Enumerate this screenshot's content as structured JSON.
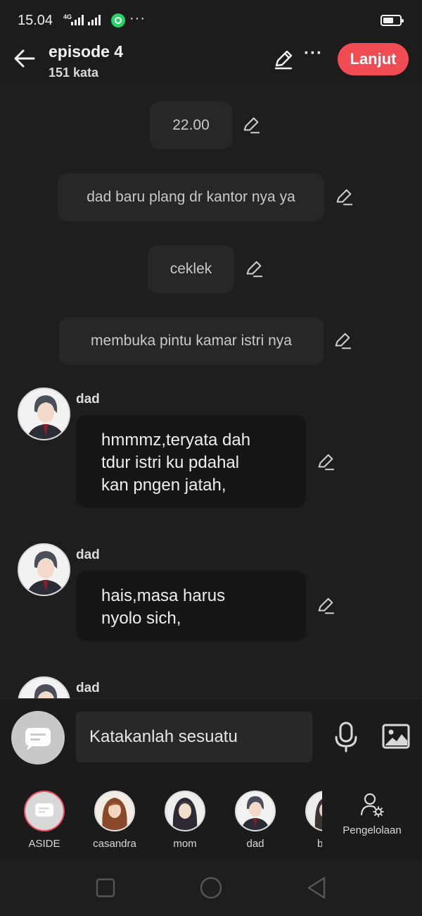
{
  "status_bar": {
    "time": "15.04",
    "network": "4G"
  },
  "header": {
    "title": "episode 4",
    "word_count": "151 kata",
    "next_button": "Lanjut"
  },
  "messages": [
    {
      "type": "narration",
      "text": "22.00"
    },
    {
      "type": "narration",
      "text": "dad baru plang dr kantor nya ya"
    },
    {
      "type": "narration",
      "text": "ceklek"
    },
    {
      "type": "narration",
      "text": "membuka pintu kamar istri nya"
    },
    {
      "type": "dialog",
      "speaker": "dad",
      "lines": [
        "hmmmz,teryata dah",
        "tdur istri ku pdahal",
        "kan pngen jatah,"
      ]
    },
    {
      "type": "dialog",
      "speaker": "dad",
      "lines": [
        "hais,masa harus",
        "nyolo sich,"
      ]
    },
    {
      "type": "dialog",
      "speaker": "dad",
      "lines": []
    }
  ],
  "input": {
    "placeholder": "Katakanlah sesuatu"
  },
  "characters": [
    {
      "label": "ASIDE"
    },
    {
      "label": "casandra"
    },
    {
      "label": "mom"
    },
    {
      "label": "dad"
    },
    {
      "label": "b"
    }
  ],
  "management_label": "Pengelolaan",
  "colors": {
    "accent": "#f14b54",
    "background": "#1e1e1e",
    "narration_bubble": "#272727",
    "speech_bubble": "#161616"
  }
}
